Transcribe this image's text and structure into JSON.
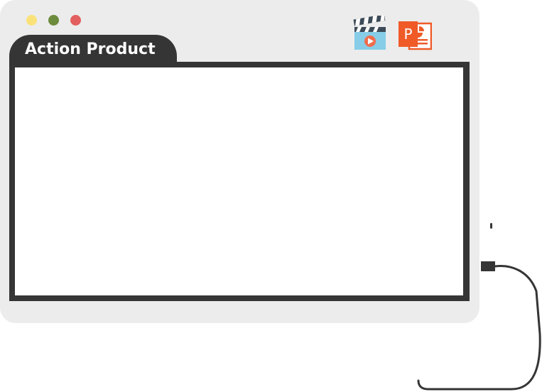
{
  "window": {
    "title": "Action Product",
    "background_color": "#ececec",
    "frame_color": "#353535",
    "content_color": "#ffffff"
  },
  "window_controls": [
    {
      "name": "minimize",
      "color": "#fae27a"
    },
    {
      "name": "maximize",
      "color": "#6d8b3d"
    },
    {
      "name": "close",
      "color": "#e35f5f"
    }
  ],
  "toolbar_icons": [
    {
      "icon": "video-clapperboard-icon",
      "accent": "#ef6d4d",
      "base": "#87cde8"
    },
    {
      "icon": "powerpoint-icon",
      "accent": "#ef5a27",
      "letter": "P"
    }
  ],
  "cable": {
    "color": "#353535"
  }
}
